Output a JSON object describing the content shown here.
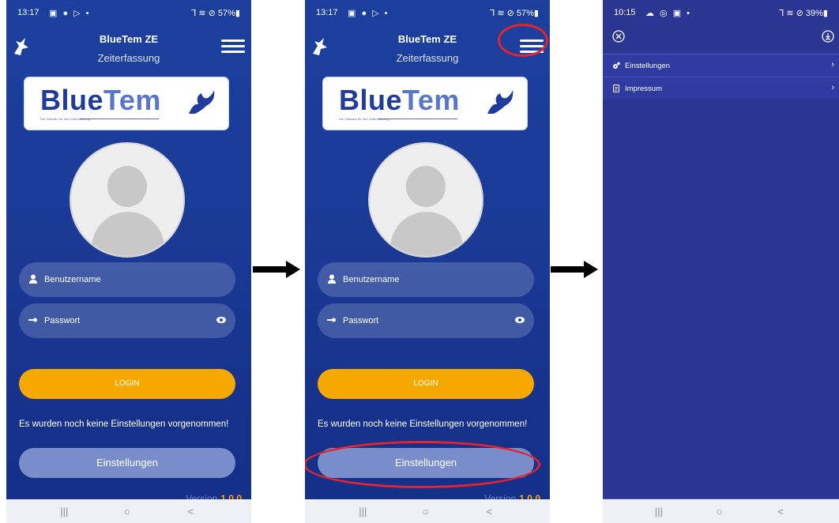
{
  "screens": [
    {
      "status": {
        "time": "13:17",
        "notif_icons": "▣ ● ▷ •",
        "right": "⅂ ≋ ⊘ 57%▮"
      },
      "header": {
        "title": "BlueTem ZE",
        "subtitle": "Zeiterfassung"
      },
      "brand": {
        "word_part1": "Blue",
        "word_part2": "Tem",
        "tagline": "Die Software für Ihre Unterstützung"
      },
      "form": {
        "username_placeholder": "Benutzername",
        "password_placeholder": "Passwort"
      },
      "login_label": "LOGIN",
      "notice": "Es wurden noch keine Einstellungen vorgenommen!",
      "settings_label": "Einstellungen",
      "version_label": "Version",
      "version_number": "1.0.0"
    },
    {
      "status": {
        "time": "13:17",
        "notif_icons": "▣ ● ▷ •",
        "right": "⅂ ≋ ⊘ 57%▮"
      },
      "header": {
        "title": "BlueTem ZE",
        "subtitle": "Zeiterfassung"
      },
      "brand": {
        "word_part1": "Blue",
        "word_part2": "Tem",
        "tagline": "Die Software für Ihre Unterstützung"
      },
      "form": {
        "username_placeholder": "Benutzername",
        "password_placeholder": "Passwort"
      },
      "login_label": "LOGIN",
      "notice": "Es wurden noch keine Einstellungen vorgenommen!",
      "settings_label": "Einstellungen",
      "version_label": "Version",
      "version_number": "1.0.0"
    },
    {
      "status": {
        "time": "10:15",
        "notif_icons": "☁ ◎ ▣ •",
        "right": "⅂ ≋ ⊘ 39%▮"
      },
      "menu_items": [
        {
          "label": "Einstellungen",
          "icon": "gears-icon"
        },
        {
          "label": "Impressum",
          "icon": "document-icon"
        }
      ]
    }
  ],
  "navbar": {
    "recent": "|||",
    "home": "○",
    "back": "<"
  },
  "colors": {
    "bg_blue": "#1c3f9e",
    "login_orange": "#f5a800",
    "highlight_red": "#e4232f",
    "menu_bg": "#2b3592"
  }
}
